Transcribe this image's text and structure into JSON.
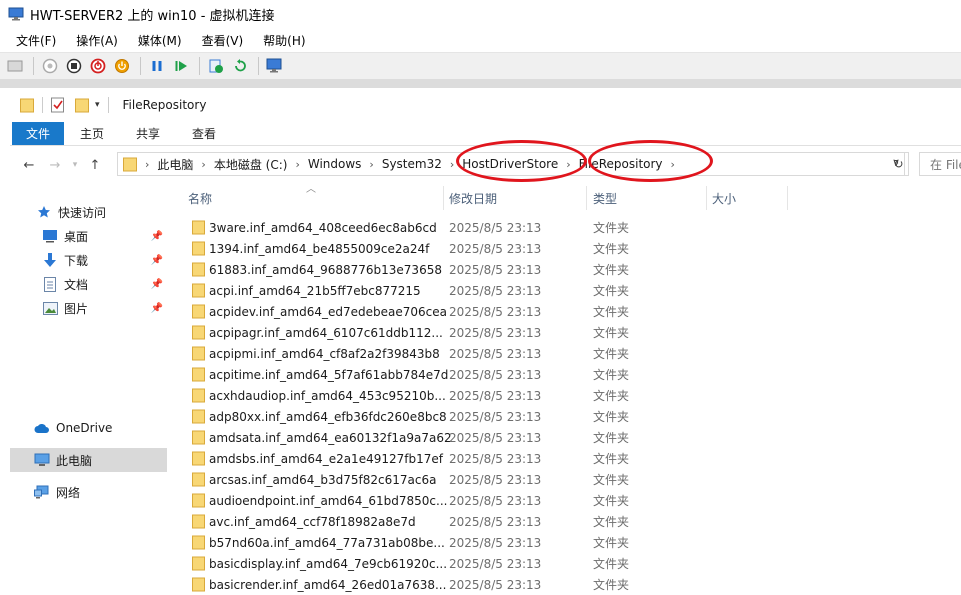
{
  "vm": {
    "title": "HWT-SERVER2 上的 win10 - 虚拟机连接",
    "menu": [
      "文件(F)",
      "操作(A)",
      "媒体(M)",
      "查看(V)",
      "帮助(H)"
    ]
  },
  "explorer": {
    "window_title": "FileRepository",
    "ribbon_tabs": [
      "文件",
      "主页",
      "共享",
      "查看"
    ],
    "breadcrumbs": [
      "此电脑",
      "本地磁盘 (C:)",
      "Windows",
      "System32",
      "HostDriverStore",
      "FileRepository"
    ],
    "search_placeholder": "在 File",
    "nav": {
      "quick_access": "快速访问",
      "desktop": "桌面",
      "downloads": "下载",
      "documents": "文档",
      "pictures": "图片",
      "onedrive": "OneDrive",
      "this_pc": "此电脑",
      "network": "网络"
    },
    "columns": {
      "name": "名称",
      "modified": "修改日期",
      "type": "类型",
      "size": "大小"
    },
    "files": [
      {
        "name": "3ware.inf_amd64_408ceed6ec8ab6cd",
        "date": "2025/8/5 23:13",
        "type": "文件夹"
      },
      {
        "name": "1394.inf_amd64_be4855009ce2a24f",
        "date": "2025/8/5 23:13",
        "type": "文件夹"
      },
      {
        "name": "61883.inf_amd64_9688776b13e73658",
        "date": "2025/8/5 23:13",
        "type": "文件夹"
      },
      {
        "name": "acpi.inf_amd64_21b5ff7ebc877215",
        "date": "2025/8/5 23:13",
        "type": "文件夹"
      },
      {
        "name": "acpidev.inf_amd64_ed7edebeae706cea",
        "date": "2025/8/5 23:13",
        "type": "文件夹"
      },
      {
        "name": "acpipagr.inf_amd64_6107c61ddb112...",
        "date": "2025/8/5 23:13",
        "type": "文件夹"
      },
      {
        "name": "acpipmi.inf_amd64_cf8af2a2f39843b8",
        "date": "2025/8/5 23:13",
        "type": "文件夹"
      },
      {
        "name": "acpitime.inf_amd64_5f7af61abb784e7d",
        "date": "2025/8/5 23:13",
        "type": "文件夹"
      },
      {
        "name": "acxhdaudiop.inf_amd64_453c95210b...",
        "date": "2025/8/5 23:13",
        "type": "文件夹"
      },
      {
        "name": "adp80xx.inf_amd64_efb36fdc260e8bc8",
        "date": "2025/8/5 23:13",
        "type": "文件夹"
      },
      {
        "name": "amdsata.inf_amd64_ea60132f1a9a7a62",
        "date": "2025/8/5 23:13",
        "type": "文件夹"
      },
      {
        "name": "amdsbs.inf_amd64_e2a1e49127fb17ef",
        "date": "2025/8/5 23:13",
        "type": "文件夹"
      },
      {
        "name": "arcsas.inf_amd64_b3d75f82c617ac6a",
        "date": "2025/8/5 23:13",
        "type": "文件夹"
      },
      {
        "name": "audioendpoint.inf_amd64_61bd7850c...",
        "date": "2025/8/5 23:13",
        "type": "文件夹"
      },
      {
        "name": "avc.inf_amd64_ccf78f18982a8e7d",
        "date": "2025/8/5 23:13",
        "type": "文件夹"
      },
      {
        "name": "b57nd60a.inf_amd64_77a731ab08be...",
        "date": "2025/8/5 23:13",
        "type": "文件夹"
      },
      {
        "name": "basicdisplay.inf_amd64_7e9cb61920c...",
        "date": "2025/8/5 23:13",
        "type": "文件夹"
      },
      {
        "name": "basicrender.inf_amd64_26ed01a7638...",
        "date": "2025/8/5 23:13",
        "type": "文件夹"
      }
    ]
  },
  "colors": {
    "ribbon_file_tab": "#1979ca",
    "annotation_circle": "#e0151d",
    "folder_yellow": "#f8d775"
  }
}
